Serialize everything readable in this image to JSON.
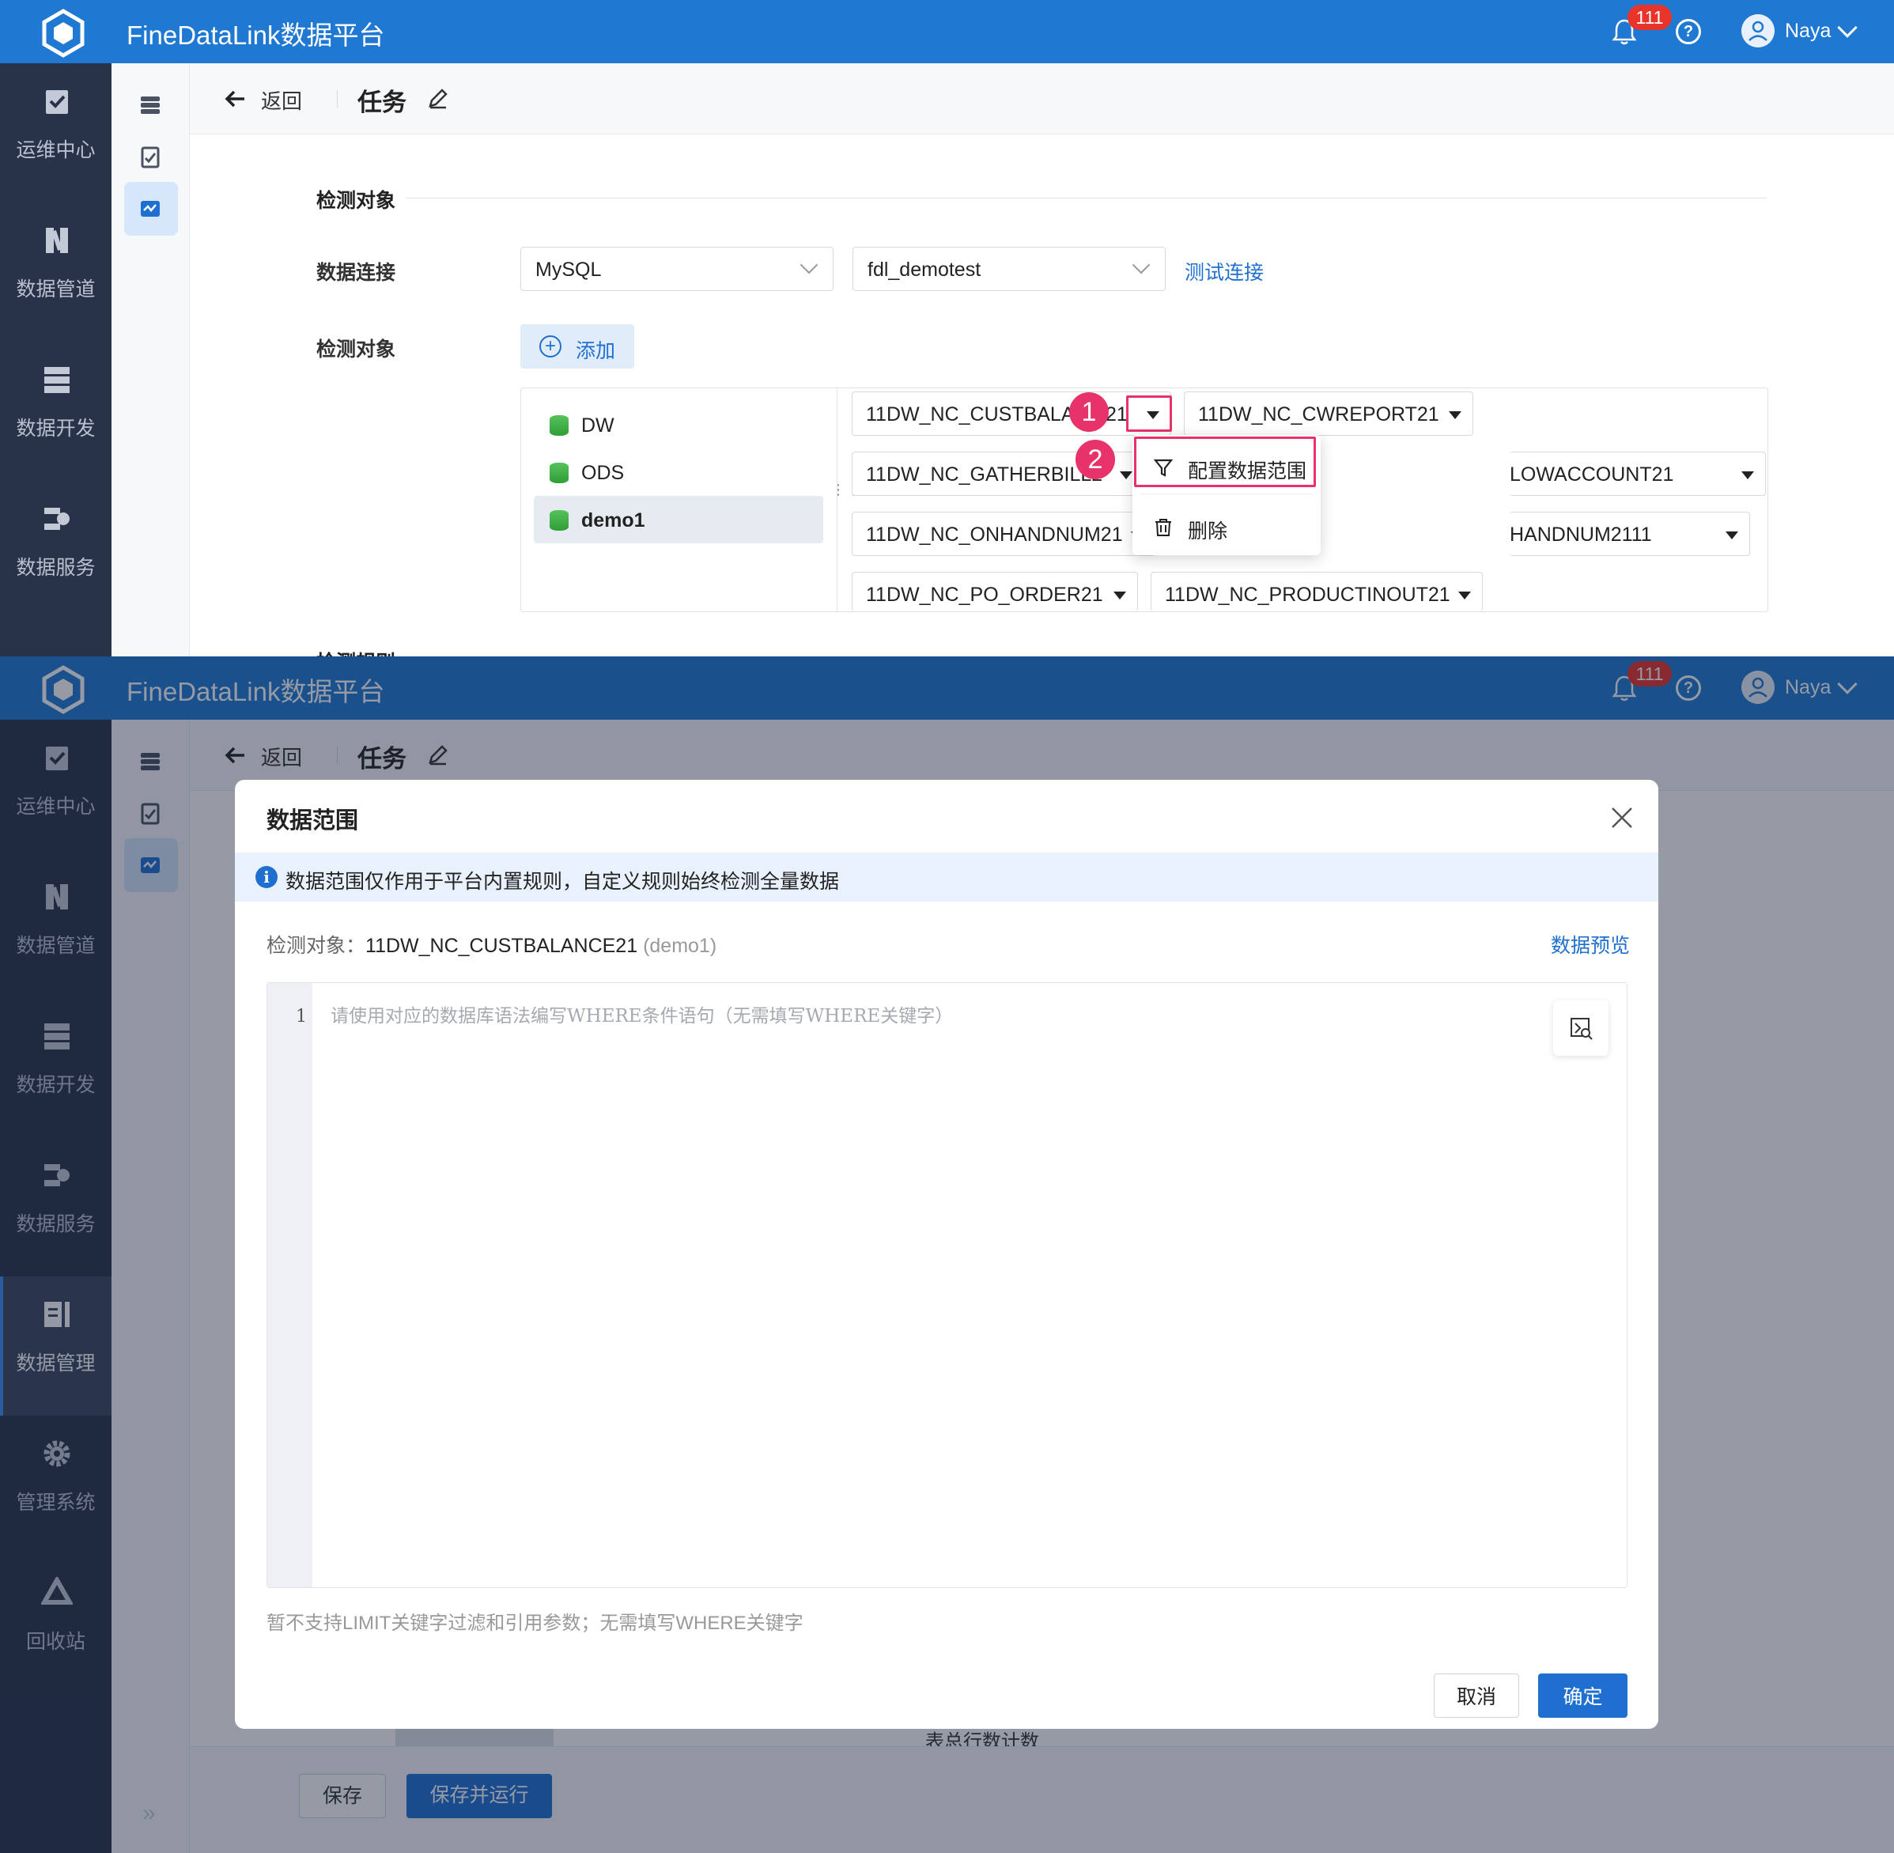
{
  "app": {
    "title": "FineDataLink数据平台",
    "notification_count": "111",
    "username": "Naya"
  },
  "leftnav": {
    "items": [
      {
        "label": "运维中心",
        "icon": "ops-icon"
      },
      {
        "label": "数据管道",
        "icon": "pipeline-icon"
      },
      {
        "label": "数据开发",
        "icon": "dev-icon"
      },
      {
        "label": "数据服务",
        "icon": "service-icon"
      },
      {
        "label": "数据管理",
        "icon": "manage-icon"
      },
      {
        "label": "管理系统",
        "icon": "gear-icon"
      },
      {
        "label": "回收站",
        "icon": "recycle-icon"
      }
    ],
    "active": "数据管理"
  },
  "header": {
    "back_label": "返回",
    "title": "任务"
  },
  "form": {
    "section_title": "检测对象",
    "connection_label": "数据连接",
    "db_type": "MySQL",
    "connection_name": "fdl_demotest",
    "test_connection": "测试连接",
    "objects_label": "检测对象",
    "add_label": "添加",
    "next_section_peek": "检测规则",
    "tree": [
      "DW",
      "ODS",
      "demo1"
    ],
    "selected_tree_item": "demo1",
    "tables": [
      {
        "name": "11DW_NC_CUSTBALANCE21",
        "visible": "11DW_NC_CUSTBALAN"
      },
      {
        "name": "11DW_NC_CWREPORT21",
        "visible": "11DW_NC_CWREPORT21"
      },
      {
        "name": "11DW_NC_GATHERBILL21",
        "visible": "11DW_NC_GATHERBILL2"
      },
      {
        "name": "11DW_NC_FLOWACCOUNT21",
        "visible": "LOWACCOUNT21"
      },
      {
        "name": "11DW_NC_ONHANDNUM21",
        "visible": "11DW_NC_ONHANDNUM21"
      },
      {
        "name": "11DW_NC_ONHANDNUM2111",
        "visible": "HANDNUM2111"
      },
      {
        "name": "11DW_NC_PO_ORDER21",
        "visible": "11DW_NC_PO_ORDER21"
      },
      {
        "name": "11DW_NC_PRODUCTINOUT21",
        "visible": "11DW_NC_PRODUCTINOUT21"
      }
    ],
    "tag_suffix": "21",
    "step1": "1",
    "step2": "2",
    "menu": {
      "configure_range": "配置数据范围",
      "delete": "删除"
    }
  },
  "modal": {
    "title": "数据范围",
    "notice": "数据范围仅作用于平台内置规则，自定义规则始终检测全量数据",
    "object_key": "检测对象：",
    "object_name": "11DW_NC_CUSTBALANCE21",
    "object_schema": "(demo1)",
    "preview_link": "数据预览",
    "line_number": "1",
    "placeholder": "请使用对应的数据库语法编写WHERE条件语句（无需填写WHERE关键字）",
    "hint": "暂不支持LIMIT关键字过滤和引用参数；无需填写WHERE关键字",
    "cancel": "取消",
    "ok": "确定"
  },
  "footer": {
    "save": "保存",
    "save_run": "保存并运行",
    "under_text": "表总行数计数"
  },
  "colors": {
    "topbar": "#1f78d1",
    "nav": "#28334a",
    "accent": "#1f6fd1",
    "highlight": "#e8336a",
    "badge": "#e8342a"
  }
}
